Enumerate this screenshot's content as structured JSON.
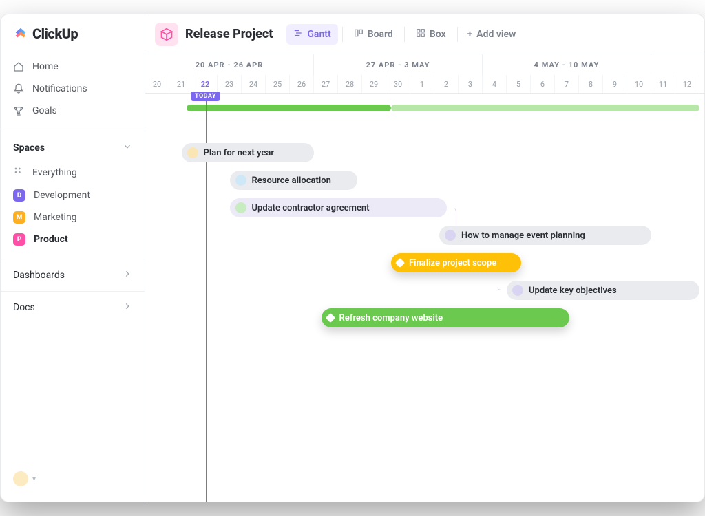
{
  "brand": {
    "name": "ClickUp"
  },
  "sidebar": {
    "nav": [
      {
        "label": "Home",
        "icon": "home"
      },
      {
        "label": "Notifications",
        "icon": "bell"
      },
      {
        "label": "Goals",
        "icon": "trophy"
      }
    ],
    "spaces_header": "Spaces",
    "everything_label": "Everything",
    "spaces": [
      {
        "label": "Development",
        "letter": "D",
        "color": "purple"
      },
      {
        "label": "Marketing",
        "letter": "M",
        "color": "orange"
      },
      {
        "label": "Product",
        "letter": "P",
        "color": "pink",
        "active": true
      }
    ],
    "dashboards_label": "Dashboards",
    "docs_label": "Docs"
  },
  "topbar": {
    "project_title": "Release Project",
    "views": [
      {
        "label": "Gantt",
        "active": true
      },
      {
        "label": "Board"
      },
      {
        "label": "Box"
      }
    ],
    "add_view_label": "Add view"
  },
  "timeline": {
    "day_width": 35,
    "start_offset_days": 0,
    "today_index": 2,
    "today_label": "TODAY",
    "weeks": [
      {
        "label": "20 APR - 26 APR",
        "span_days": 7,
        "lead_days": 2
      },
      {
        "label": "27 APR - 3 MAY",
        "span_days": 7
      },
      {
        "label": "4 MAY - 10 MAY",
        "span_days": 7
      }
    ],
    "days": [
      "20",
      "21",
      "22",
      "23",
      "24",
      "25",
      "26",
      "27",
      "28",
      "29",
      "30",
      "1",
      "2",
      "3",
      "4",
      "5",
      "6",
      "7",
      "8",
      "9",
      "10",
      "11",
      "12"
    ]
  },
  "month_bar": {
    "solid_start": 1.7,
    "solid_end": 10.2,
    "light_start": 10.2,
    "light_end": 23
  },
  "tasks": [
    {
      "id": "t1",
      "label": "Plan for next year",
      "start": 1.5,
      "end": 7.0,
      "row": 0,
      "style": "gray",
      "dot": "cream"
    },
    {
      "id": "t2",
      "label": "Resource allocation",
      "start": 3.5,
      "end": 8.8,
      "row": 1,
      "style": "gray",
      "dot": "blue"
    },
    {
      "id": "t3",
      "label": "Update contractor agreement",
      "start": 3.5,
      "end": 12.5,
      "row": 2,
      "style": "lav",
      "dot": "green"
    },
    {
      "id": "t4",
      "label": "How to manage event planning",
      "start": 12.2,
      "end": 21.0,
      "row": 3,
      "style": "gray",
      "dot": "lav"
    },
    {
      "id": "t5",
      "label": "Finalize project scope",
      "start": 10.2,
      "end": 15.6,
      "row": 4,
      "style": "yellow",
      "diamond": true,
      "shadow": true
    },
    {
      "id": "t6",
      "label": "Update key objectives",
      "start": 15.0,
      "end": 23.0,
      "row": 5,
      "style": "gray",
      "dot": "lav"
    },
    {
      "id": "t7",
      "label": "Refresh company website",
      "start": 7.3,
      "end": 17.6,
      "row": 6,
      "style": "green",
      "diamond": true,
      "shadow": true
    }
  ],
  "chart_data": {
    "type": "gantt",
    "title": "Release Project",
    "x_axis": {
      "unit": "day",
      "start": "2020-04-20",
      "end": "2020-05-12"
    },
    "today": "2020-04-22",
    "bars": [
      {
        "name": "Plan for next year",
        "start": "2020-04-21",
        "end": "2020-04-27"
      },
      {
        "name": "Resource allocation",
        "start": "2020-04-23",
        "end": "2020-04-28"
      },
      {
        "name": "Update contractor agreement",
        "start": "2020-04-23",
        "end": "2020-05-02"
      },
      {
        "name": "How to manage event planning",
        "start": "2020-05-02",
        "end": "2020-05-10"
      },
      {
        "name": "Finalize project scope",
        "start": "2020-04-30",
        "end": "2020-05-05"
      },
      {
        "name": "Update key objectives",
        "start": "2020-05-05",
        "end": "2020-05-12"
      },
      {
        "name": "Refresh company website",
        "start": "2020-04-27",
        "end": "2020-05-07"
      }
    ]
  }
}
